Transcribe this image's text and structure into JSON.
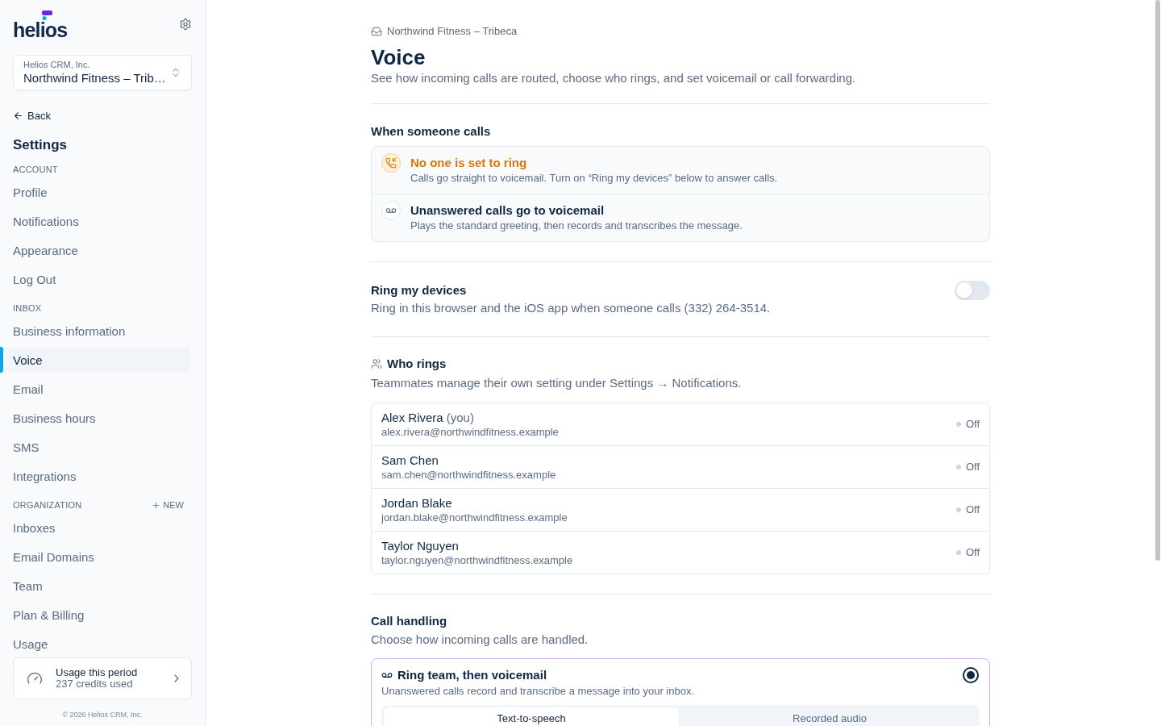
{
  "sidebar": {
    "logo": "helios",
    "org_switcher": {
      "company": "Helios CRM, Inc.",
      "location": "Northwind Fitness – Trib…"
    },
    "back_link": "Back",
    "title": "Settings",
    "sections": [
      {
        "heading": "ACCOUNT",
        "items": [
          {
            "label": "Profile",
            "selected": false
          },
          {
            "label": "Notifications",
            "selected": false
          },
          {
            "label": "Appearance",
            "selected": false
          },
          {
            "label": "Log Out",
            "selected": false
          }
        ]
      },
      {
        "heading": "INBOX",
        "items": [
          {
            "label": "Business information",
            "selected": false
          },
          {
            "label": "Voice",
            "selected": true
          },
          {
            "label": "Email",
            "selected": false
          },
          {
            "label": "Business hours",
            "selected": false
          },
          {
            "label": "SMS",
            "selected": false
          },
          {
            "label": "Integrations",
            "selected": false
          }
        ]
      },
      {
        "heading": "ORGANIZATION",
        "action": "NEW",
        "items": [
          {
            "label": "Inboxes",
            "selected": false
          },
          {
            "label": "Email Domains",
            "selected": false
          },
          {
            "label": "Team",
            "selected": false
          },
          {
            "label": "Plan & Billing",
            "selected": false
          },
          {
            "label": "Usage",
            "selected": false
          }
        ]
      }
    ],
    "usage_card": {
      "title": "Usage this period",
      "detail": "237 credits used"
    },
    "footer": "© 2026 Helios CRM, Inc."
  },
  "main": {
    "breadcrumb": "Northwind Fitness – Tribeca",
    "title": "Voice",
    "subtitle": "See how incoming calls are routed, choose who rings, and set voicemail or call forwarding.",
    "routing": {
      "heading": "When someone calls",
      "notices": [
        {
          "kind": "warning",
          "title": "No one is set to ring",
          "description": "Calls go straight to voicemail. Turn on “Ring my devices” below to answer calls."
        },
        {
          "kind": "voicemail",
          "title": "Unanswered calls go to voicemail",
          "description": "Plays the standard greeting, then records and transcribes the message."
        }
      ]
    },
    "ring_devices": {
      "title": "Ring my devices",
      "description": "Ring in this browser and the iOS app when someone calls (332) 264-3514.",
      "on": false
    },
    "who_rings": {
      "heading": "Who rings",
      "description": "Teammates manage their own setting under Settings → Notifications.",
      "members": [
        {
          "name": "Alex Rivera",
          "note": "(you)",
          "email": "alex.rivera@northwindfitness.example",
          "status": "Off",
          "on": false
        },
        {
          "name": "Sam Chen",
          "email": "sam.chen@northwindfitness.example",
          "status": "Off",
          "on": false
        },
        {
          "name": "Jordan Blake",
          "email": "jordan.blake@northwindfitness.example",
          "status": "Off",
          "on": false
        },
        {
          "name": "Taylor Nguyen",
          "email": "taylor.nguyen@northwindfitness.example",
          "status": "Off",
          "on": false
        }
      ]
    },
    "call_handling": {
      "heading": "Call handling",
      "description": "Choose how incoming calls are handled.",
      "options": [
        {
          "title": "Ring team, then voicemail",
          "description": "Unanswered calls record and transcribe a message into your inbox.",
          "selected": true,
          "greeting_tabs": [
            {
              "label": "Text-to-speech",
              "selected": true
            },
            {
              "label": "Recorded audio",
              "selected": false
            }
          ]
        }
      ]
    }
  }
}
